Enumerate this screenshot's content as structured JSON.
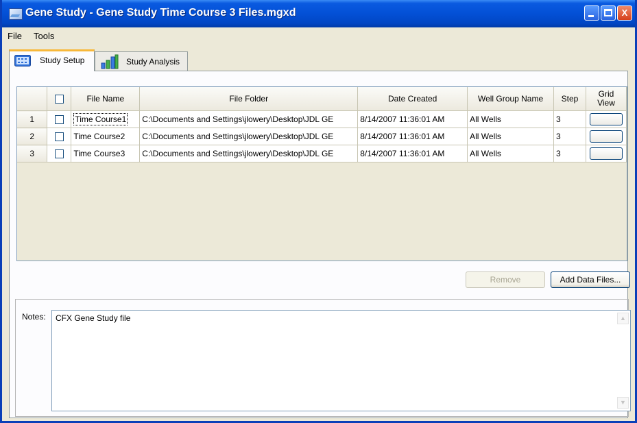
{
  "window": {
    "title": "Gene Study - Gene Study Time Course 3 Files.mgxd",
    "minimize_label": "_",
    "maximize_label": "□",
    "close_label": "X"
  },
  "menu": {
    "items": [
      "File",
      "Tools"
    ]
  },
  "tabs": [
    {
      "label": "Study Setup",
      "icon": "grid-icon",
      "active": true
    },
    {
      "label": "Study Analysis",
      "icon": "bar-chart-icon",
      "active": false
    }
  ],
  "table": {
    "headers": {
      "file_name": "File Name",
      "file_folder": "File Folder",
      "date_created": "Date Created",
      "well_group_name": "Well Group Name",
      "step": "Step",
      "grid_view": "Grid View"
    },
    "rows": [
      {
        "num": "1",
        "file_name": "Time Course1",
        "file_folder": "C:\\Documents and Settings\\jlowery\\Desktop\\JDL GE",
        "date_created": "8/14/2007 11:36:01 AM",
        "well_group_name": "All Wells",
        "step": "3"
      },
      {
        "num": "2",
        "file_name": "Time Course2",
        "file_folder": "C:\\Documents and Settings\\jlowery\\Desktop\\JDL GE",
        "date_created": "8/14/2007 11:36:01 AM",
        "well_group_name": "All Wells",
        "step": "3"
      },
      {
        "num": "3",
        "file_name": "Time Course3",
        "file_folder": "C:\\Documents and Settings\\jlowery\\Desktop\\JDL GE",
        "date_created": "8/14/2007 11:36:01 AM",
        "well_group_name": "All Wells",
        "step": "3"
      }
    ]
  },
  "buttons": {
    "remove": "Remove",
    "add_data_files": "Add Data Files..."
  },
  "notes": {
    "label": "Notes:",
    "value": "CFX Gene Study file"
  },
  "colors": {
    "titlebar": "#0350d6",
    "tab_highlight": "#f8b83a",
    "window_bg": "#ece9d8"
  }
}
